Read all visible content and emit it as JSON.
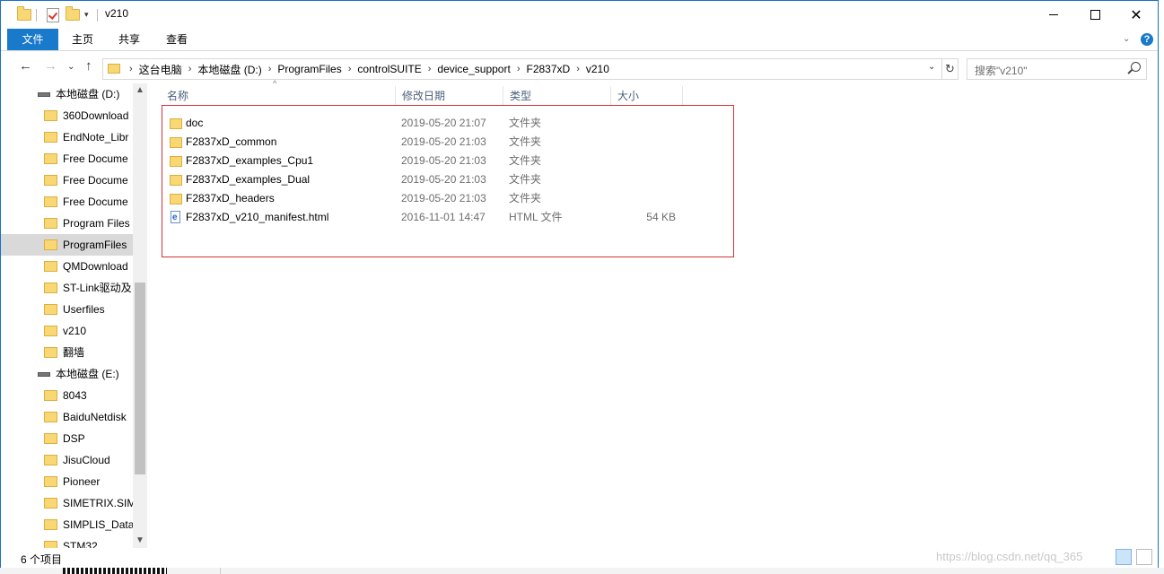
{
  "window": {
    "title": "v210",
    "controls": {
      "minimize": "—",
      "maximize": "☐",
      "close": "✕"
    }
  },
  "ribbon": {
    "tabs": [
      "文件",
      "主页",
      "共享",
      "查看"
    ],
    "help": "?",
    "collapse": "⌃"
  },
  "nav": {
    "back": "←",
    "forward": "→",
    "dropdown": "⌄",
    "up": "↑",
    "breadcrumbs": [
      "这台电脑",
      "本地磁盘 (D:)",
      "ProgramFiles",
      "controlSUITE",
      "device_support",
      "F2837xD",
      "v210"
    ],
    "separator": "›",
    "refresh": "↻"
  },
  "search": {
    "placeholder": "搜索\"v210\""
  },
  "navpane": {
    "items": [
      {
        "label": "本地磁盘 (D:)",
        "kind": "drive"
      },
      {
        "label": "360Download",
        "kind": "folder"
      },
      {
        "label": "EndNote_Libr",
        "kind": "folder"
      },
      {
        "label": "Free Docume",
        "kind": "folder"
      },
      {
        "label": "Free Docume",
        "kind": "folder"
      },
      {
        "label": "Free Docume",
        "kind": "folder"
      },
      {
        "label": "Program Files",
        "kind": "folder"
      },
      {
        "label": "ProgramFiles",
        "kind": "folder",
        "selected": true
      },
      {
        "label": "QMDownload",
        "kind": "folder"
      },
      {
        "label": "ST-Link驱动及",
        "kind": "folder"
      },
      {
        "label": "Userfiles",
        "kind": "folder"
      },
      {
        "label": "v210",
        "kind": "folder"
      },
      {
        "label": "翻墙",
        "kind": "folder"
      },
      {
        "label": "本地磁盘 (E:)",
        "kind": "drive"
      },
      {
        "label": "8043",
        "kind": "folder"
      },
      {
        "label": "BaiduNetdisk",
        "kind": "folder"
      },
      {
        "label": "DSP",
        "kind": "folder"
      },
      {
        "label": "JisuCloud",
        "kind": "folder"
      },
      {
        "label": "Pioneer",
        "kind": "folder"
      },
      {
        "label": "SIMETRIX.SIM",
        "kind": "folder"
      },
      {
        "label": "SIMPLIS_Data",
        "kind": "folder"
      },
      {
        "label": "STM32",
        "kind": "folder"
      }
    ]
  },
  "columns": {
    "name": "名称",
    "date": "修改日期",
    "type": "类型",
    "size": "大小",
    "sort_indicator": "^"
  },
  "files": [
    {
      "name": "doc",
      "date": "2019-05-20 21:07",
      "type": "文件夹",
      "size": "",
      "icon": "folder-icon"
    },
    {
      "name": "F2837xD_common",
      "date": "2019-05-20 21:03",
      "type": "文件夹",
      "size": "",
      "icon": "folder-icon"
    },
    {
      "name": "F2837xD_examples_Cpu1",
      "date": "2019-05-20 21:03",
      "type": "文件夹",
      "size": "",
      "icon": "folder-icon"
    },
    {
      "name": "F2837xD_examples_Dual",
      "date": "2019-05-20 21:03",
      "type": "文件夹",
      "size": "",
      "icon": "folder-icon"
    },
    {
      "name": "F2837xD_headers",
      "date": "2019-05-20 21:03",
      "type": "文件夹",
      "size": "",
      "icon": "folder-icon"
    },
    {
      "name": "F2837xD_v210_manifest.html",
      "date": "2016-11-01 14:47",
      "type": "HTML 文件",
      "size": "54 KB",
      "icon": "html-file-icon"
    }
  ],
  "status": {
    "count": "6 个项目"
  },
  "watermark": "https://blog.csdn.net/qq_365"
}
